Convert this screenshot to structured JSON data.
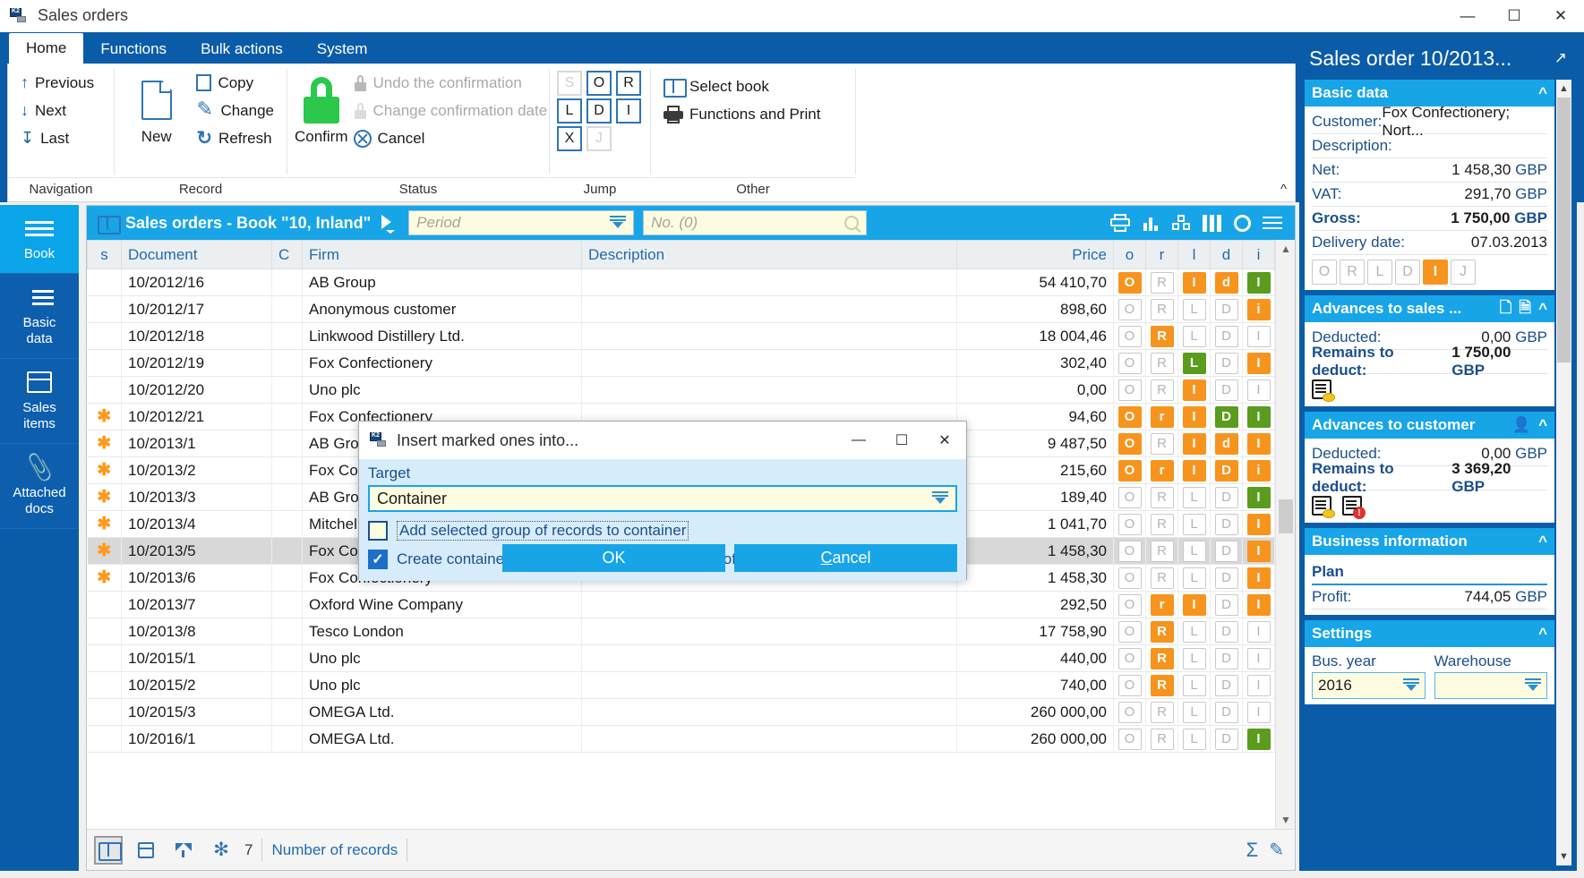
{
  "window": {
    "title": "Sales orders",
    "minimize": "—",
    "maximize": "☐",
    "close": "✕"
  },
  "ribbon": {
    "tabs": [
      {
        "label": "Home",
        "active": true
      },
      {
        "label": "Functions",
        "active": false
      },
      {
        "label": "Bulk actions",
        "active": false
      },
      {
        "label": "System",
        "active": false
      }
    ],
    "groups": [
      {
        "label": "Navigation",
        "items": [
          {
            "label": "Previous",
            "icon": "arrow-up-icon",
            "disabled": false
          },
          {
            "label": "Next",
            "icon": "arrow-down-icon",
            "disabled": false
          },
          {
            "label": "Last",
            "icon": "arrow-last-icon",
            "disabled": false
          }
        ]
      },
      {
        "label": "Record",
        "big": {
          "label": "New",
          "icon": "document-icon"
        },
        "items": [
          {
            "label": "Copy",
            "icon": "copy-icon",
            "disabled": false
          },
          {
            "label": "Change",
            "icon": "pencil-icon",
            "disabled": false
          },
          {
            "label": "Refresh",
            "icon": "refresh-icon",
            "disabled": false
          }
        ]
      },
      {
        "label": "Status",
        "big": {
          "label": "Confirm",
          "icon": "lock-icon"
        },
        "items": [
          {
            "label": "Undo the confirmation",
            "icon": "lock-small-icon",
            "disabled": true
          },
          {
            "label": "Change confirmation date",
            "icon": "lock-small-light-icon",
            "disabled": true
          },
          {
            "label": "Cancel",
            "icon": "cancel-circle-icon",
            "disabled": false
          }
        ]
      },
      {
        "label": "Jump",
        "boxes": [
          {
            "key": "S",
            "enabled": false
          },
          {
            "key": "O",
            "enabled": true
          },
          {
            "key": "R",
            "enabled": true
          },
          {
            "key": "L",
            "enabled": true
          },
          {
            "key": "D",
            "enabled": true
          },
          {
            "key": "I",
            "enabled": true
          },
          {
            "key": "X",
            "enabled": true
          },
          {
            "key": "J",
            "enabled": false
          }
        ]
      },
      {
        "label": "Other",
        "items": [
          {
            "label": "Select book",
            "icon": "book-icon",
            "disabled": false
          },
          {
            "label": "Functions and Print",
            "icon": "printer-icon",
            "disabled": false
          }
        ]
      }
    ]
  },
  "leftnav": {
    "items": [
      {
        "label": "Book",
        "icon": "hamburger-icon",
        "active": true
      },
      {
        "label": "Basic\ndata",
        "label1": "Basic",
        "label2": "data",
        "icon": "list-icon",
        "active": false
      },
      {
        "label": "Sales items",
        "label1": "Sales",
        "label2": "items",
        "icon": "box-icon",
        "active": false
      },
      {
        "label": "Attached docs",
        "label1": "Attached",
        "label2": "docs",
        "icon": "paperclip-icon",
        "active": false
      }
    ]
  },
  "grid": {
    "header_title": "Sales orders - Book \"10, Inland\"",
    "period_placeholder": "Period",
    "no_placeholder": "No. (0)",
    "tools": [
      "printer-icon",
      "bar-chart-icon",
      "pivot-cube-icon",
      "columns-icon",
      "gear-icon",
      "menu-icon"
    ],
    "columns": [
      {
        "key": "s",
        "label": "s",
        "align": "center"
      },
      {
        "key": "document",
        "label": "Document",
        "align": "left"
      },
      {
        "key": "c",
        "label": "C",
        "align": "left"
      },
      {
        "key": "firm",
        "label": "Firm",
        "align": "left"
      },
      {
        "key": "description",
        "label": "Description",
        "align": "left"
      },
      {
        "key": "price",
        "label": "Price",
        "align": "right"
      },
      {
        "key": "o",
        "label": "o",
        "align": "center"
      },
      {
        "key": "r",
        "label": "r",
        "align": "center"
      },
      {
        "key": "l",
        "label": "l",
        "align": "center"
      },
      {
        "key": "d",
        "label": "d",
        "align": "center"
      },
      {
        "key": "i",
        "label": "i",
        "align": "center"
      }
    ],
    "rows": [
      {
        "s": "",
        "document": "10/2012/16",
        "c": "",
        "firm": "AB Group",
        "description": "",
        "price": "54 410,70",
        "flags": [
          {
            "t": "O",
            "st": "on"
          },
          {
            "t": "R",
            "st": "off"
          },
          {
            "t": "I",
            "st": "on"
          },
          {
            "t": "d",
            "st": "on"
          },
          {
            "t": "I",
            "st": "green"
          }
        ],
        "selected": false
      },
      {
        "s": "",
        "document": "10/2012/17",
        "c": "",
        "firm": "Anonymous customer",
        "description": "",
        "price": "898,60",
        "flags": [
          {
            "t": "O",
            "st": "off"
          },
          {
            "t": "R",
            "st": "off"
          },
          {
            "t": "L",
            "st": "off"
          },
          {
            "t": "D",
            "st": "off"
          },
          {
            "t": "i",
            "st": "on"
          }
        ],
        "selected": false
      },
      {
        "s": "",
        "document": "10/2012/18",
        "c": "",
        "firm": "Linkwood Distillery Ltd.",
        "description": "",
        "price": "18 004,46",
        "flags": [
          {
            "t": "O",
            "st": "off"
          },
          {
            "t": "R",
            "st": "on"
          },
          {
            "t": "L",
            "st": "off"
          },
          {
            "t": "D",
            "st": "off"
          },
          {
            "t": "I",
            "st": "off"
          }
        ],
        "selected": false
      },
      {
        "s": "",
        "document": "10/2012/19",
        "c": "",
        "firm": "Fox Confectionery",
        "description": "",
        "price": "302,40",
        "flags": [
          {
            "t": "O",
            "st": "off"
          },
          {
            "t": "R",
            "st": "off"
          },
          {
            "t": "L",
            "st": "green"
          },
          {
            "t": "D",
            "st": "off"
          },
          {
            "t": "I",
            "st": "on"
          }
        ],
        "selected": false
      },
      {
        "s": "",
        "document": "10/2012/20",
        "c": "",
        "firm": "Uno plc",
        "description": "",
        "price": "0,00",
        "flags": [
          {
            "t": "O",
            "st": "off"
          },
          {
            "t": "R",
            "st": "off"
          },
          {
            "t": "I",
            "st": "on"
          },
          {
            "t": "D",
            "st": "off"
          },
          {
            "t": "I",
            "st": "off"
          }
        ],
        "selected": false
      },
      {
        "s": "✱",
        "document": "10/2012/21",
        "c": "",
        "firm": "Fox Confectionery",
        "description": "",
        "price": "94,60",
        "flags": [
          {
            "t": "O",
            "st": "on"
          },
          {
            "t": "r",
            "st": "on"
          },
          {
            "t": "I",
            "st": "on"
          },
          {
            "t": "D",
            "st": "green"
          },
          {
            "t": "I",
            "st": "green"
          }
        ],
        "selected": false
      },
      {
        "s": "✱",
        "document": "10/2013/1",
        "c": "",
        "firm": "AB Group",
        "description": "",
        "price": "9 487,50",
        "flags": [
          {
            "t": "O",
            "st": "on"
          },
          {
            "t": "R",
            "st": "off"
          },
          {
            "t": "I",
            "st": "on"
          },
          {
            "t": "d",
            "st": "on"
          },
          {
            "t": "I",
            "st": "on"
          }
        ],
        "selected": false
      },
      {
        "s": "✱",
        "document": "10/2013/2",
        "c": "",
        "firm": "Fox Confectionery",
        "description": "",
        "price": "215,60",
        "flags": [
          {
            "t": "O",
            "st": "on"
          },
          {
            "t": "r",
            "st": "on"
          },
          {
            "t": "I",
            "st": "on"
          },
          {
            "t": "D",
            "st": "on"
          },
          {
            "t": "i",
            "st": "on"
          }
        ],
        "selected": false
      },
      {
        "s": "✱",
        "document": "10/2013/3",
        "c": "",
        "firm": "AB Group",
        "description": "",
        "price": "189,40",
        "flags": [
          {
            "t": "O",
            "st": "off"
          },
          {
            "t": "R",
            "st": "off"
          },
          {
            "t": "L",
            "st": "off"
          },
          {
            "t": "D",
            "st": "off"
          },
          {
            "t": "I",
            "st": "green"
          }
        ],
        "selected": false
      },
      {
        "s": "✱",
        "document": "10/2013/4",
        "c": "",
        "firm": "Mitchell Ltd.",
        "description": "",
        "price": "1 041,70",
        "flags": [
          {
            "t": "O",
            "st": "off"
          },
          {
            "t": "R",
            "st": "off"
          },
          {
            "t": "L",
            "st": "off"
          },
          {
            "t": "D",
            "st": "off"
          },
          {
            "t": "I",
            "st": "on"
          }
        ],
        "selected": false
      },
      {
        "s": "✱",
        "document": "10/2013/5",
        "c": "",
        "firm": "Fox Confectionery",
        "description": "",
        "price": "1 458,30",
        "flags": [
          {
            "t": "O",
            "st": "off"
          },
          {
            "t": "R",
            "st": "off"
          },
          {
            "t": "L",
            "st": "off"
          },
          {
            "t": "D",
            "st": "off"
          },
          {
            "t": "I",
            "st": "on"
          }
        ],
        "selected": true
      },
      {
        "s": "✱",
        "document": "10/2013/6",
        "c": "",
        "firm": "Fox Confectionery",
        "description": "",
        "price": "1 458,30",
        "flags": [
          {
            "t": "O",
            "st": "off"
          },
          {
            "t": "R",
            "st": "off"
          },
          {
            "t": "L",
            "st": "off"
          },
          {
            "t": "D",
            "st": "off"
          },
          {
            "t": "I",
            "st": "on"
          }
        ],
        "selected": false
      },
      {
        "s": "",
        "document": "10/2013/7",
        "c": "",
        "firm": "Oxford Wine Company",
        "description": "",
        "price": "292,50",
        "flags": [
          {
            "t": "O",
            "st": "off"
          },
          {
            "t": "r",
            "st": "on"
          },
          {
            "t": "I",
            "st": "on"
          },
          {
            "t": "D",
            "st": "off"
          },
          {
            "t": "I",
            "st": "on"
          }
        ],
        "selected": false
      },
      {
        "s": "",
        "document": "10/2013/8",
        "c": "",
        "firm": "Tesco London",
        "description": "",
        "price": "17 758,90",
        "flags": [
          {
            "t": "O",
            "st": "off"
          },
          {
            "t": "R",
            "st": "on"
          },
          {
            "t": "L",
            "st": "off"
          },
          {
            "t": "D",
            "st": "off"
          },
          {
            "t": "I",
            "st": "off"
          }
        ],
        "selected": false
      },
      {
        "s": "",
        "document": "10/2015/1",
        "c": "",
        "firm": "Uno plc",
        "description": "",
        "price": "440,00",
        "flags": [
          {
            "t": "O",
            "st": "off"
          },
          {
            "t": "R",
            "st": "on"
          },
          {
            "t": "L",
            "st": "off"
          },
          {
            "t": "D",
            "st": "off"
          },
          {
            "t": "I",
            "st": "off"
          }
        ],
        "selected": false
      },
      {
        "s": "",
        "document": "10/2015/2",
        "c": "",
        "firm": "Uno plc",
        "description": "",
        "price": "740,00",
        "flags": [
          {
            "t": "O",
            "st": "off"
          },
          {
            "t": "R",
            "st": "on"
          },
          {
            "t": "L",
            "st": "off"
          },
          {
            "t": "D",
            "st": "off"
          },
          {
            "t": "I",
            "st": "off"
          }
        ],
        "selected": false
      },
      {
        "s": "",
        "document": "10/2015/3",
        "c": "",
        "firm": "OMEGA Ltd.",
        "description": "",
        "price": "260 000,00",
        "flags": [
          {
            "t": "O",
            "st": "off"
          },
          {
            "t": "R",
            "st": "off"
          },
          {
            "t": "L",
            "st": "off"
          },
          {
            "t": "D",
            "st": "off"
          },
          {
            "t": "I",
            "st": "off"
          }
        ],
        "selected": false
      },
      {
        "s": "",
        "document": "10/2016/1",
        "c": "",
        "firm": "OMEGA Ltd.",
        "description": "",
        "price": "260 000,00",
        "flags": [
          {
            "t": "O",
            "st": "off"
          },
          {
            "t": "R",
            "st": "off"
          },
          {
            "t": "L",
            "st": "off"
          },
          {
            "t": "D",
            "st": "off"
          },
          {
            "t": "I",
            "st": "green"
          }
        ],
        "selected": false
      }
    ],
    "footer": {
      "marked_count": "7",
      "records_label": "Number of records",
      "icons": [
        "book-icon",
        "container-icon",
        "filter-icon",
        "snowflake-icon"
      ],
      "right_icons": [
        "sum-icon",
        "edit-icon"
      ]
    }
  },
  "dialog": {
    "title": "Insert marked ones into...",
    "minimize": "—",
    "maximize": "☐",
    "close": "✕",
    "target_label": "Target",
    "target_value": "Container",
    "checkbox1": {
      "label": "Add selected group of records to container",
      "checked": false
    },
    "checkbox2": {
      "label": "Create container containing only selected group of records",
      "checked": true
    },
    "ok_label": "OK",
    "cancel_label": "Cancel"
  },
  "rightpanel": {
    "title": "Sales order 10/2013...",
    "popout_icon": "popout-icon",
    "sections": [
      {
        "title": "Basic data",
        "fields": [
          {
            "label": "Customer:",
            "value": "Fox Confectionery; Nort...",
            "bold": false
          },
          {
            "label": "Description:",
            "value": "",
            "bold": false
          },
          {
            "label": "Net:",
            "value": "1 458,30",
            "currency": "GBP",
            "bold": false
          },
          {
            "label": "VAT:",
            "value": "291,70",
            "currency": "GBP",
            "bold": false
          },
          {
            "label": "Gross:",
            "value": "1 750,00",
            "currency": "GBP",
            "bold": true
          },
          {
            "label": "Delivery date:",
            "value": "07.03.2013",
            "bold": false
          }
        ],
        "badges": [
          {
            "t": "O",
            "on": false
          },
          {
            "t": "R",
            "on": false
          },
          {
            "t": "L",
            "on": false
          },
          {
            "t": "D",
            "on": false
          },
          {
            "t": "I",
            "on": true
          },
          {
            "t": "J",
            "on": false
          }
        ]
      },
      {
        "title": "Advances to sales ...",
        "fields": [
          {
            "label": "Deducted:",
            "value": "0,00",
            "currency": "GBP",
            "bold": false
          },
          {
            "label": "Remains to deduct:",
            "value": "1 750,00",
            "currency": "GBP",
            "bold": true
          }
        ],
        "action_icons": [
          "document-copy-icon",
          "document-list-icon"
        ],
        "body_icons": [
          "invoice-coin-icon"
        ]
      },
      {
        "title": "Advances to customer",
        "fields": [
          {
            "label": "Deducted:",
            "value": "0,00",
            "currency": "GBP",
            "bold": false
          },
          {
            "label": "Remains to deduct:",
            "value": "3 369,20",
            "currency": "GBP",
            "bold": true
          }
        ],
        "action_icons": [
          "person-card-icon"
        ],
        "body_icons": [
          "invoice-coin-icon",
          "invoice-alert-icon"
        ]
      },
      {
        "title": "Business information",
        "plan_label": "Plan",
        "fields": [
          {
            "label": "Profit:",
            "value": "744,05",
            "currency": "GBP",
            "bold": false
          }
        ]
      },
      {
        "title": "Settings",
        "settings": [
          {
            "label": "Bus. year",
            "value": "2016"
          },
          {
            "label": "Warehouse",
            "value": ""
          }
        ]
      }
    ]
  }
}
